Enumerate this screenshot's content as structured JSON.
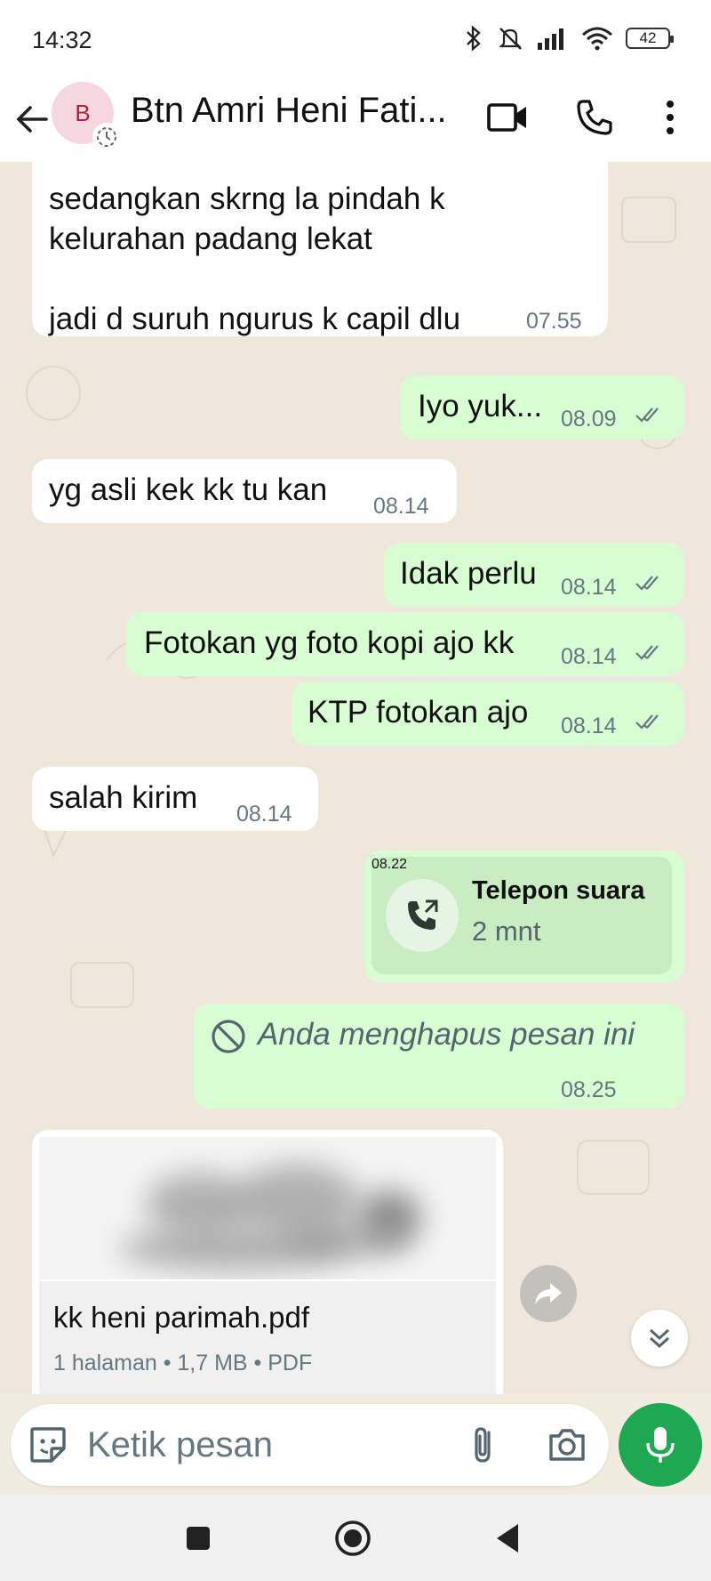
{
  "status_bar": {
    "time": "14:32",
    "battery": "42",
    "icons": [
      "bluetooth-icon",
      "mute-icon",
      "signal-icon",
      "wifi-icon",
      "battery-icon"
    ]
  },
  "header": {
    "avatar_initial": "B",
    "contact_name": "Btn Amri Heni Fati...",
    "icons": [
      "back-arrow-icon",
      "video-call-icon",
      "phone-icon",
      "more-vert-icon"
    ]
  },
  "messages": [
    {
      "dir": "in",
      "lines": [
        "sedangkan skrng la pindah k",
        "kelurahan padang lekat",
        "",
        "jadi d suruh ngurus k capil dlu"
      ],
      "time": "07.55"
    },
    {
      "dir": "out",
      "text": "Iyo yuk...",
      "time": "08.09",
      "read": true
    },
    {
      "dir": "in",
      "text": "yg asli kek kk tu kan",
      "time": "08.14"
    },
    {
      "dir": "out",
      "text": "Idak perlu",
      "time": "08.14",
      "read": true
    },
    {
      "dir": "out",
      "text": "Fotokan yg foto kopi ajo kk",
      "time": "08.14",
      "read": true
    },
    {
      "dir": "out",
      "text": "KTP fotokan ajo",
      "time": "08.14",
      "read": true
    },
    {
      "dir": "in",
      "text": "salah kirim",
      "time": "08.14"
    },
    {
      "dir": "out",
      "type": "call",
      "title": "Telepon suara",
      "duration": "2 mnt",
      "time": "08.22"
    },
    {
      "dir": "out",
      "type": "deleted",
      "text": "Anda menghapus pesan ini",
      "time": "08.25"
    },
    {
      "dir": "in",
      "type": "document",
      "file_name": "kk heni parimah.pdf",
      "meta": "1 halaman • 1,7 MB • PDF"
    }
  ],
  "composer": {
    "placeholder": "Ketik pesan"
  },
  "colors": {
    "incoming_bubble": "#ffffff",
    "outgoing_bubble": "#d9fdd3",
    "accent_green": "#1da851",
    "read_ticks": "#667781",
    "chat_background": "#efe7db"
  }
}
